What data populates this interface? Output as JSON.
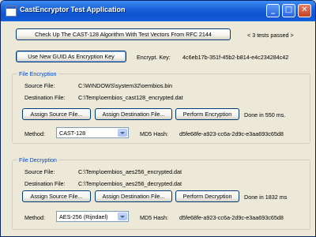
{
  "window": {
    "title": "CastEncryptor Test Application",
    "buttons": {
      "minimize": "_",
      "maximize": "□",
      "close": "✕"
    }
  },
  "header": {
    "test_button": "Check Up The CAST-128 Algorithm With Test Vectors From RFC 2144",
    "tests_status": "< 3 tests passed >",
    "guid_button": "Use New GUID As Encryption Key",
    "key_label": "Encrypt. Key:",
    "key_value": "4c6eb17b-351f-45b2-b814-e4c234284c42"
  },
  "encryption": {
    "group_title": "File Encryption",
    "source_label": "Source File:",
    "source_value": "C:\\WINDOWS\\system32\\oembios.bin",
    "dest_label": "Destination File:",
    "dest_value": "C:\\Temp\\oembios_cast128_encrypted.dat",
    "assign_source": "Assign Source File...",
    "assign_dest": "Assign Destination File...",
    "perform": "Perform Encryption",
    "status": "Done in 550 ms.",
    "method_label": "Method:",
    "method_value": "CAST-128",
    "md5_label": "MD5 Hash:",
    "md5_value": "d5fe68fe-a923-cc6a-2d9c-e3aa693c65d8"
  },
  "decryption": {
    "group_title": "File Decryption",
    "source_label": "Source File:",
    "source_value": "C:\\Temp\\oembios_aes256_encrypted.dat",
    "dest_label": "Destination File:",
    "dest_value": "C:\\Temp\\oembios_aes256_decrypted.dat",
    "assign_source": "Assign Source File...",
    "assign_dest": "Assign Destination File...",
    "perform": "Perform Decryption",
    "status": "Done in 1832 ms",
    "method_label": "Method:",
    "method_value": "AES-256 (Rijndael)",
    "md5_label": "MD5 Hash:",
    "md5_value": "d5fe68fe-a923-cc6a-2d9c-e3aa693c65d8"
  }
}
